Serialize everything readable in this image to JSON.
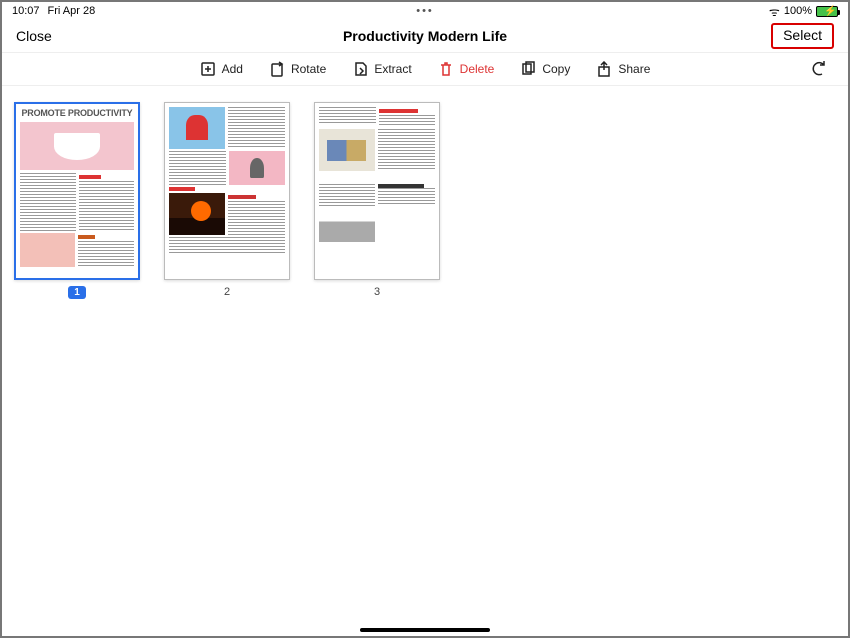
{
  "status": {
    "time": "10:07",
    "date": "Fri Apr 28",
    "ellipsis": "•••",
    "battery_pct": "100%"
  },
  "nav": {
    "close": "Close",
    "title": "Productivity Modern Life",
    "select": "Select"
  },
  "toolbar": {
    "add": "Add",
    "rotate": "Rotate",
    "extract": "Extract",
    "delete": "Delete",
    "copy": "Copy",
    "share": "Share"
  },
  "pages": [
    {
      "num": "1",
      "selected": true,
      "headline": "PROMOTE PRODUCTIVITY"
    },
    {
      "num": "2",
      "selected": false,
      "headline": ""
    },
    {
      "num": "3",
      "selected": false,
      "headline": ""
    }
  ]
}
